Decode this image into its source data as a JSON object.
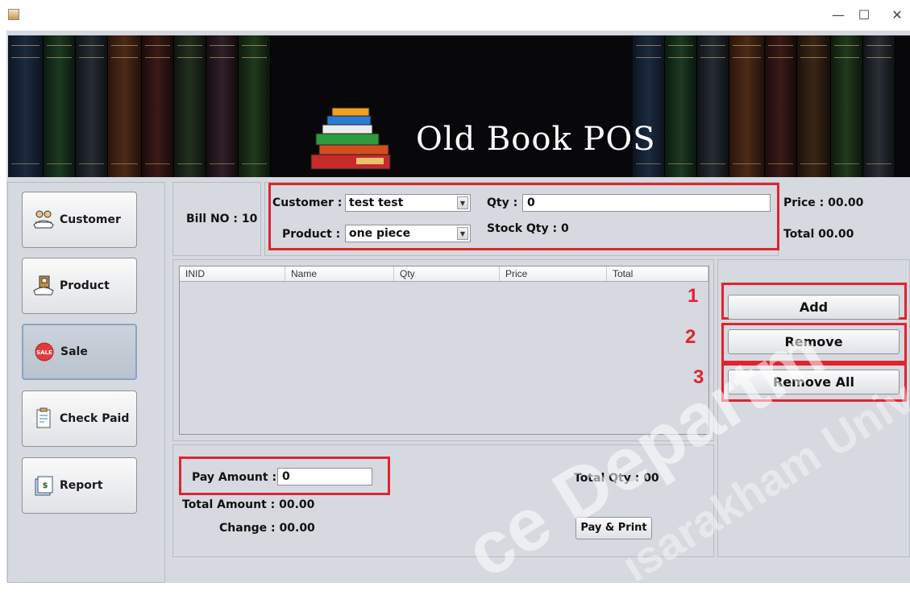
{
  "window": {
    "minimize_glyph": "—",
    "maximize_glyph": "☐",
    "close_glyph": "✕"
  },
  "banner": {
    "title": "Old Book POS"
  },
  "sidebar": {
    "items": [
      {
        "label": "Customer",
        "icon": "customer-icon"
      },
      {
        "label": "Product",
        "icon": "product-icon"
      },
      {
        "label": "Sale",
        "icon": "sale-icon"
      },
      {
        "label": "Check Paid",
        "icon": "check-paid-icon"
      },
      {
        "label": "Report",
        "icon": "report-icon"
      }
    ],
    "active": "Sale"
  },
  "bill": {
    "label": "Bill NO : 10"
  },
  "form": {
    "customer_label": "Customer :",
    "customer_value": "test test",
    "product_label": "Product :",
    "product_value": "one piece",
    "qty_label": "Qty :",
    "qty_value": "0",
    "stock_label": "Stock Qty : 0"
  },
  "summary": {
    "price": "Price : 00.00",
    "total": "Total  00.00"
  },
  "table": {
    "columns": [
      "INID",
      "Name",
      "Qty",
      "Price",
      "Total"
    ],
    "rows": []
  },
  "actions": {
    "add": {
      "label": "Add",
      "marker": "1"
    },
    "remove": {
      "label": "Remove",
      "marker": "2"
    },
    "remove_all": {
      "label": "Remove All",
      "marker": "3"
    }
  },
  "payment": {
    "pay_amount_label": "Pay Amount :",
    "pay_amount_value": "0",
    "total_amount": "Total Amount : 00.00",
    "change": "Change : 00.00",
    "total_qty": "Total Qty : 00",
    "pay_print_label": "Pay & Print"
  },
  "colors": {
    "highlight": "#e1232f",
    "background": "#d6d9df",
    "banner": "#08080b"
  }
}
